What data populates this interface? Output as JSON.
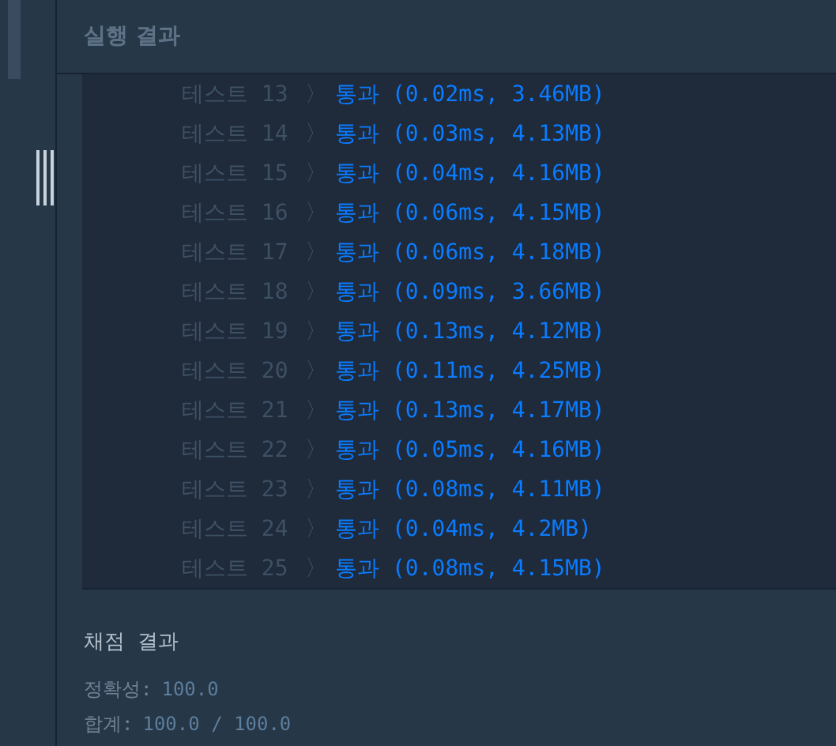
{
  "panel_title": "실행 결과",
  "results": [
    {
      "test": "테스트 13",
      "separator": "〉",
      "result": "통과",
      "detail": "(0.02ms, 3.46MB)"
    },
    {
      "test": "테스트 14",
      "separator": "〉",
      "result": "통과",
      "detail": "(0.03ms, 4.13MB)"
    },
    {
      "test": "테스트 15",
      "separator": "〉",
      "result": "통과",
      "detail": "(0.04ms, 4.16MB)"
    },
    {
      "test": "테스트 16",
      "separator": "〉",
      "result": "통과",
      "detail": "(0.06ms, 4.15MB)"
    },
    {
      "test": "테스트 17",
      "separator": "〉",
      "result": "통과",
      "detail": "(0.06ms, 4.18MB)"
    },
    {
      "test": "테스트 18",
      "separator": "〉",
      "result": "통과",
      "detail": "(0.09ms, 3.66MB)"
    },
    {
      "test": "테스트 19",
      "separator": "〉",
      "result": "통과",
      "detail": "(0.13ms, 4.12MB)"
    },
    {
      "test": "테스트 20",
      "separator": "〉",
      "result": "통과",
      "detail": "(0.11ms, 4.25MB)"
    },
    {
      "test": "테스트 21",
      "separator": "〉",
      "result": "통과",
      "detail": "(0.13ms, 4.17MB)"
    },
    {
      "test": "테스트 22",
      "separator": "〉",
      "result": "통과",
      "detail": "(0.05ms, 4.16MB)"
    },
    {
      "test": "테스트 23",
      "separator": "〉",
      "result": "통과",
      "detail": "(0.08ms, 4.11MB)"
    },
    {
      "test": "테스트 24",
      "separator": "〉",
      "result": "통과",
      "detail": "(0.04ms, 4.2MB)"
    },
    {
      "test": "테스트 25",
      "separator": "〉",
      "result": "통과",
      "detail": "(0.08ms, 4.15MB)"
    }
  ],
  "grading": {
    "title": "채점 결과",
    "lines": [
      {
        "label": "정확성:",
        "value": "100.0"
      },
      {
        "label": "합계:",
        "value": "100.0 / 100.0"
      }
    ]
  }
}
